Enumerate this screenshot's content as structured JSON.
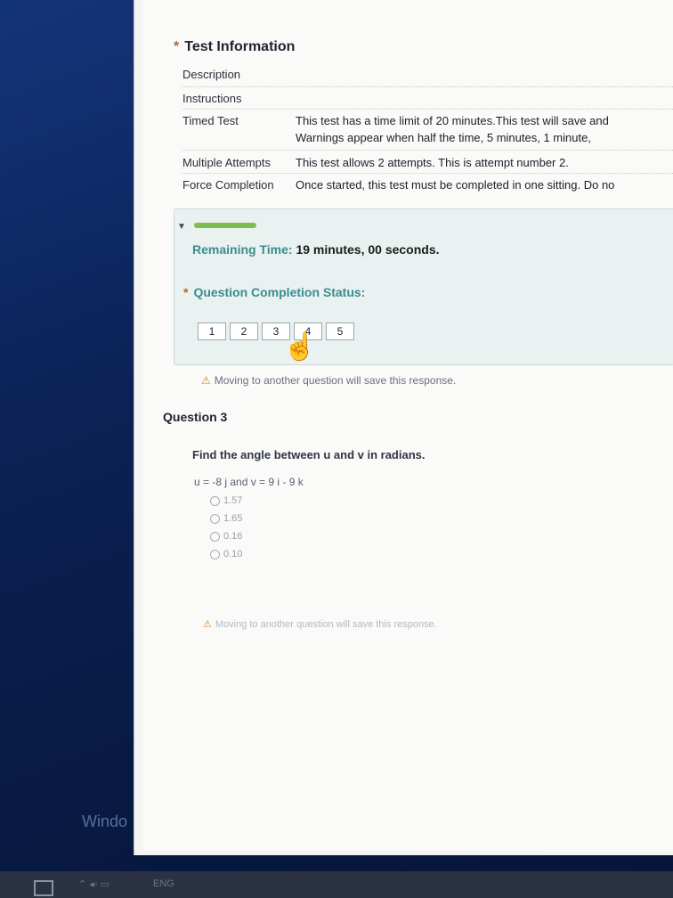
{
  "test_info": {
    "title": "Test Information",
    "rows": [
      {
        "label": "Description",
        "value": ""
      },
      {
        "label": "Instructions",
        "value": ""
      },
      {
        "label": "Timed Test",
        "value": "This test has a time limit of 20 minutes.This test will save and"
      },
      {
        "label": "Multiple Attempts",
        "value": "This test allows 2 attempts. This is attempt number 2."
      },
      {
        "label": "Force Completion",
        "value": "Once started, this test must be completed in one sitting. Do no"
      }
    ],
    "timed_line2": "Warnings appear when half the time, 5 minutes, 1 minute,"
  },
  "timer": {
    "label": "Remaining Time:",
    "value": "19 minutes, 00 seconds.",
    "progress_fraction": 0.95
  },
  "completion": {
    "label": "Question Completion Status:",
    "questions": [
      "1",
      "2",
      "3",
      "4",
      "5"
    ],
    "current": "3"
  },
  "warning_text": "Moving to another question will save this response.",
  "question": {
    "title": "Question 3",
    "prompt": "Find the angle between u and v in radians.",
    "vectors": "u = -8 j  and  v = 9 i - 9 k",
    "options": [
      "1.57",
      "1.65",
      "0.16",
      "0.10"
    ]
  },
  "desktop": {
    "watermark": "Windo",
    "taskbar_left": "⌃ ◂◦ ▭",
    "taskbar_lang": "ENG"
  }
}
